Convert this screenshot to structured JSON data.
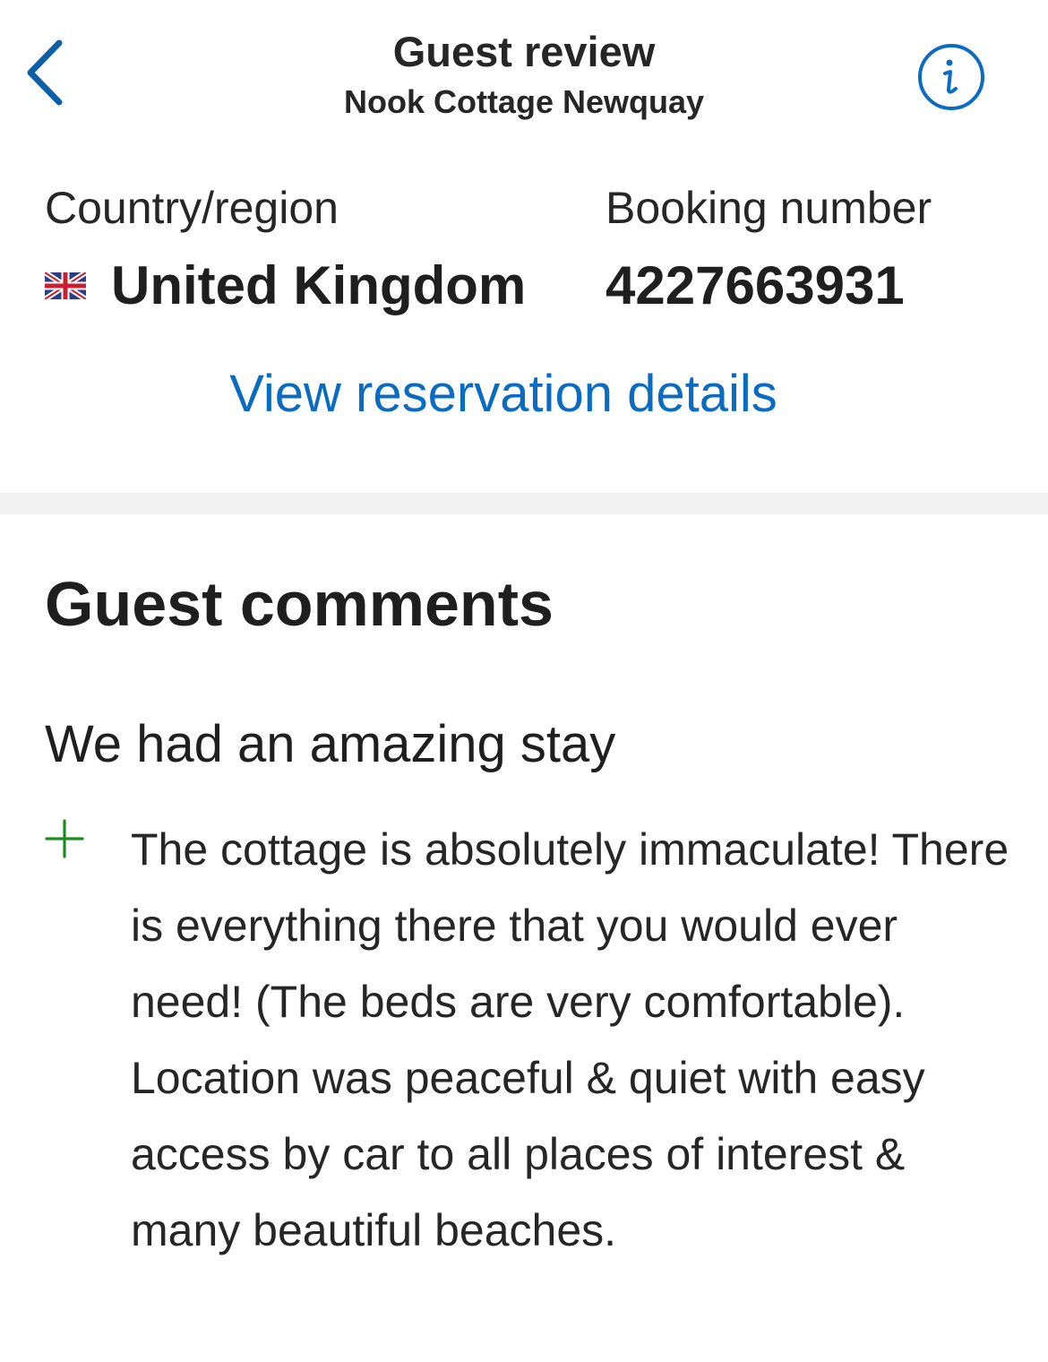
{
  "header": {
    "title": "Guest review",
    "subtitle": "Nook Cottage Newquay",
    "back_icon": "chevron-left-icon",
    "info_icon": "info-icon"
  },
  "booking": {
    "country_label": "Country/region",
    "country_value": "United Kingdom",
    "country_flag_icon": "uk-flag-icon",
    "booking_label": "Booking number",
    "booking_value": "4227663931",
    "view_details_link": "View reservation details"
  },
  "comments": {
    "heading": "Guest comments",
    "review_title": "We had an amazing stay",
    "positive_icon": "plus-icon",
    "positive_text": "The cottage is absolutely immaculate! There is everything there that you would ever need! (The beds are very comfortable).  Location was peaceful & quiet with easy access by car to all places of interest & many beautiful beaches."
  },
  "colors": {
    "accent_blue": "#0a6bc2",
    "back_blue": "#0b5fa8",
    "positive_green": "#1f8a1f",
    "divider_gray": "#f2f2f2",
    "text_dark": "#1f1f1f"
  }
}
